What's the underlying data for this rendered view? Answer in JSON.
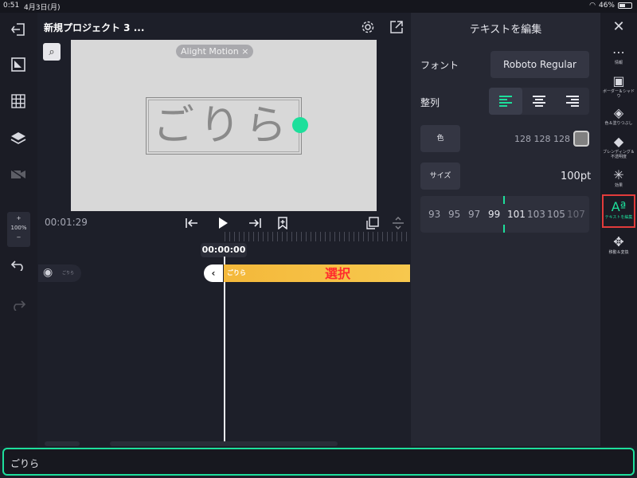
{
  "status": {
    "time": "0:51",
    "date": "4月3日(月)",
    "battery": "46%"
  },
  "project": {
    "title": "新規プロジェクト 3 ..."
  },
  "canvas": {
    "watermark": "Alight Motion ×",
    "text": "ごりら"
  },
  "left_tools": {
    "zoom_plus": "+",
    "zoom_level": "100%",
    "zoom_minus": "−"
  },
  "transport": {
    "timecode": "00:01:29"
  },
  "timeline": {
    "playhead_time": "00:00:00",
    "track_tiny_label": "ごりら",
    "clip_label": "ごりら",
    "select_annotation": "選択"
  },
  "panel": {
    "title": "テキストを編集",
    "font_label": "フォント",
    "font_value": "Roboto Regular",
    "align_label": "整列",
    "color_label": "色",
    "color_value": "128 128 128",
    "size_label": "サイズ",
    "size_value": "100pt",
    "wheel_numbers": [
      "93",
      "95",
      "97",
      "99",
      "101",
      "103",
      "105",
      "107"
    ]
  },
  "right_icons": [
    {
      "label": "情報",
      "icon": "info-icon"
    },
    {
      "label": "ボーダー＆シャドウ",
      "icon": "border-shadow-icon"
    },
    {
      "label": "色＆塗りつぶし",
      "icon": "fill-icon"
    },
    {
      "label": "ブレンディング＆不透明度",
      "icon": "blending-icon"
    },
    {
      "label": "効果",
      "icon": "effects-icon"
    },
    {
      "label": "テキストを編集",
      "icon": "text-edit-icon"
    },
    {
      "label": "移動＆変換",
      "icon": "move-transform-icon"
    }
  ],
  "text_input": {
    "value": "ごりら"
  },
  "colors": {
    "accent": "#1ddf9b",
    "clip": "#f4b83a",
    "annotation": "#ff2d2d",
    "highlight_box": "#e23b3b"
  }
}
